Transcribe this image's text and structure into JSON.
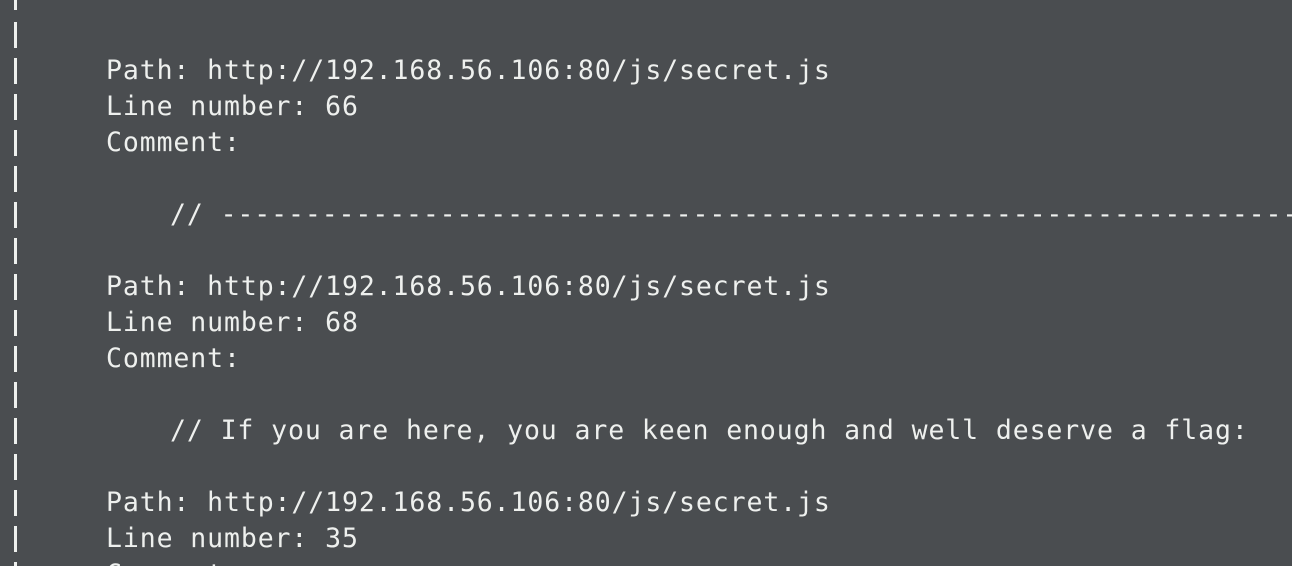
{
  "terminal": {
    "gutter_char": "|",
    "entries": [
      {
        "path": "Path: http://192.168.56.106:80/js/secret.js",
        "line_number": "Line number: 66",
        "comment_label": "Comment:",
        "comment": "// -----------------------------------------------------------------"
      },
      {
        "path": "Path: http://192.168.56.106:80/js/secret.js",
        "line_number": "Line number: 68",
        "comment_label": "Comment:",
        "comment": "// If you are here, you are keen enough and well deserve a flag:"
      },
      {
        "path": "Path: http://192.168.56.106:80/js/secret.js",
        "line_number": "Line number: 35",
        "comment_label": "Comment:"
      }
    ]
  }
}
